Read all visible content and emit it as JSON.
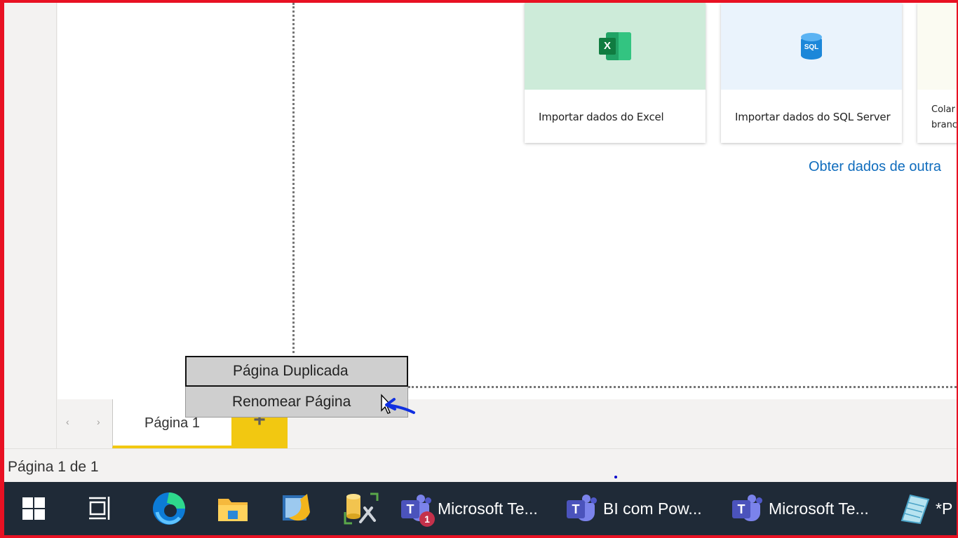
{
  "window": {
    "border_color": "#e81123"
  },
  "cards": [
    {
      "label": "Importar dados do Excel",
      "icon": "excel-icon",
      "thumb_color": "#cdebd9"
    },
    {
      "label": "Importar dados do SQL Server",
      "icon": "sql-server-icon",
      "icon_text": "SQL",
      "thumb_color": "#eaf3fc"
    },
    {
      "label_line1": "Colar",
      "label_line2": "branc"
    }
  ],
  "excel_badge": "X",
  "other_data_link": "Obter dados de outra",
  "page_tabs": {
    "prev_icon": "‹",
    "next_icon": "›",
    "active_tab": "Página 1",
    "add_page_icon": "+",
    "accent_color": "#f2c811"
  },
  "context_menu": {
    "items": [
      {
        "label": "Página Duplicada"
      },
      {
        "label": "Renomear Página"
      }
    ]
  },
  "status_bar": {
    "text": "Página 1 de 1"
  },
  "taskbar": {
    "apps": [
      {
        "icon": "windows-start-icon"
      },
      {
        "icon": "task-view-icon"
      },
      {
        "icon": "edge-icon"
      },
      {
        "icon": "file-explorer-icon"
      },
      {
        "icon": "power-bi-report-builder-icon"
      },
      {
        "icon": "database-tools-icon"
      },
      {
        "icon": "teams-icon",
        "label": "Microsoft Te...",
        "badge": "1"
      },
      {
        "icon": "teams-icon",
        "label": "BI com Pow..."
      },
      {
        "icon": "teams-icon",
        "label": "Microsoft Te..."
      },
      {
        "icon": "notepad-icon",
        "label": "*P"
      }
    ],
    "teams_letter": "T"
  }
}
